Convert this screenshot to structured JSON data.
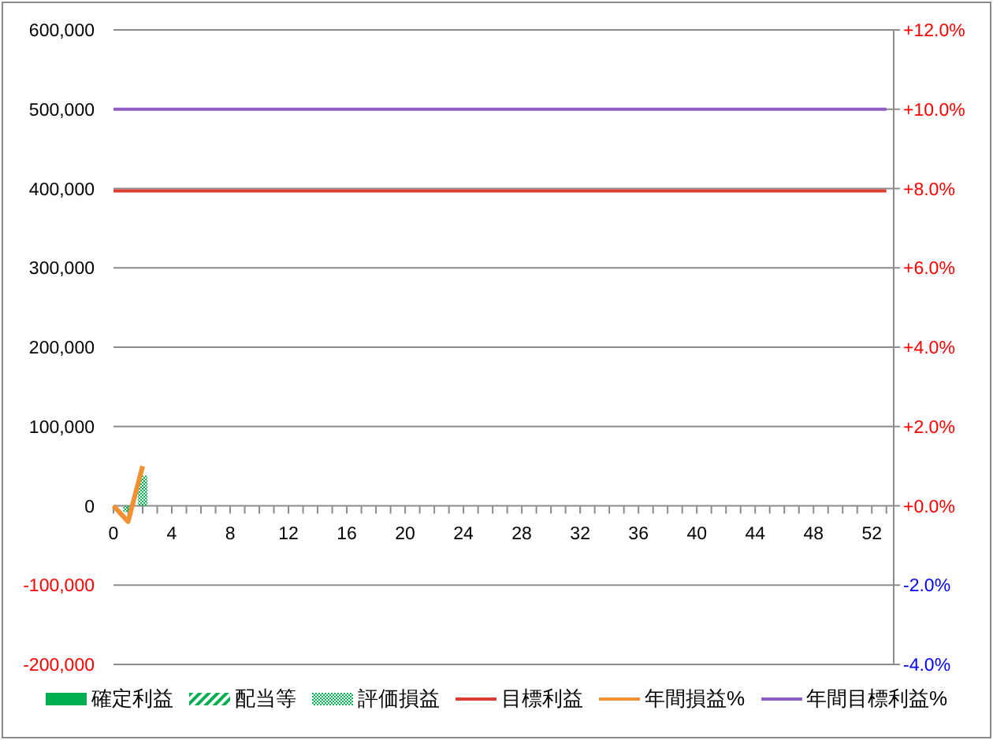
{
  "chart_data": {
    "type": "bar",
    "x": [
      0,
      1,
      2,
      53
    ],
    "xlim": [
      0,
      53.5
    ],
    "ylim": [
      -200000,
      600000
    ],
    "y2lim": [
      -4,
      12
    ],
    "xticks": [
      0,
      4,
      8,
      12,
      16,
      20,
      24,
      28,
      32,
      36,
      40,
      44,
      48,
      52
    ],
    "yticks": [
      {
        "value": 600000,
        "label": "600,000"
      },
      {
        "value": 500000,
        "label": "500,000"
      },
      {
        "value": 400000,
        "label": "400,000"
      },
      {
        "value": 300000,
        "label": "300,000"
      },
      {
        "value": 200000,
        "label": "200,000"
      },
      {
        "value": 100000,
        "label": "100,000"
      },
      {
        "value": 0,
        "label": "0"
      },
      {
        "value": -100000,
        "label": "-100,000"
      },
      {
        "value": -200000,
        "label": "-200,000"
      }
    ],
    "y2ticks": [
      {
        "value": 12,
        "label": "+12.0%"
      },
      {
        "value": 10,
        "label": "+10.0%"
      },
      {
        "value": 8,
        "label": "+8.0%"
      },
      {
        "value": 6,
        "label": "+6.0%"
      },
      {
        "value": 4,
        "label": "+4.0%"
      },
      {
        "value": 2,
        "label": "+2.0%"
      },
      {
        "value": 0,
        "label": "+0.0%"
      },
      {
        "value": -2,
        "label": "-2.0%"
      },
      {
        "value": -4,
        "label": "-4.0%"
      }
    ],
    "grid": true,
    "series": [
      {
        "name": "確定利益",
        "color": "#00b050",
        "values": [
          null,
          null,
          null,
          null
        ]
      },
      {
        "name": "配当等",
        "color": "#00b050",
        "values": [
          null,
          null,
          null,
          null
        ]
      },
      {
        "name": "評価損益",
        "color": "#00b050",
        "values": [
          null,
          -8000,
          38000,
          null
        ]
      },
      {
        "name": "目標利益",
        "type": "line",
        "color": "#e03c31",
        "values": [
          397000,
          397000,
          397000,
          397000
        ]
      },
      {
        "name": "年間損益%",
        "type": "line",
        "axis": "y2",
        "color": "#f39031",
        "values": [
          0,
          -0.4,
          1,
          null
        ]
      },
      {
        "name": "年間目標利益%",
        "type": "line",
        "axis": "y2",
        "color": "#8e5cc2",
        "values": [
          10,
          10,
          10,
          10
        ]
      }
    ]
  }
}
